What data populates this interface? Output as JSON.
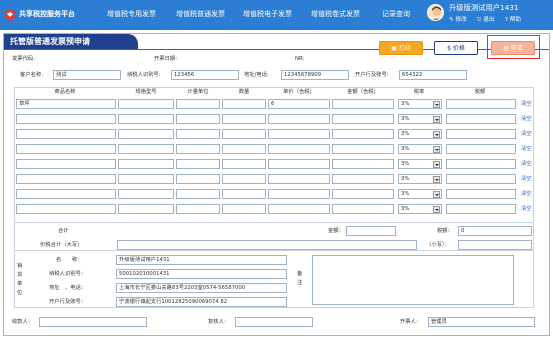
{
  "topbar": {
    "brand": "共享税控服务平台",
    "nav": [
      "增值税专用发票",
      "增值税普通发票",
      "增值税电子发票",
      "增值税卷式发票",
      "记录查询"
    ],
    "user_name": "升级版测试用户1431",
    "links": {
      "edit": "修改",
      "logout": "退出",
      "help": "帮助"
    },
    "bg_color": "#2b7ed3"
  },
  "page": {
    "title": "托管版普通发票预申请",
    "buttons": {
      "print": "打印",
      "price": "价格",
      "apply": "申请"
    },
    "meta": {
      "invoice_code": "发票代码:",
      "issue_date": "开票日期:",
      "no": "NR:"
    }
  },
  "buyer": {
    "name_label": "客户名称:",
    "name": "测试",
    "tax_label": "纳税人识别号:",
    "tax_id": "123456",
    "addr_label": "地址/电话:",
    "addr": "12345678909",
    "bank_label": "开户行及账号:",
    "bank": "654322"
  },
  "table": {
    "headers": [
      "商品名称",
      "规格型号",
      "计量单位",
      "数量",
      "单价（含税）",
      "金额（含税）",
      "税率",
      "税额"
    ],
    "rows": [
      {
        "name": "草坪",
        "spec": "",
        "unit": "",
        "qty": "",
        "price": "6",
        "amount": "",
        "rate": "3%",
        "tax": "",
        "clear": "清空"
      },
      {
        "name": "",
        "spec": "",
        "unit": "",
        "qty": "",
        "price": "",
        "amount": "",
        "rate": "3%",
        "tax": "",
        "clear": "清空"
      },
      {
        "name": "",
        "spec": "",
        "unit": "",
        "qty": "",
        "price": "",
        "amount": "",
        "rate": "3%",
        "tax": "",
        "clear": "清空"
      },
      {
        "name": "",
        "spec": "",
        "unit": "",
        "qty": "",
        "price": "",
        "amount": "",
        "rate": "3%",
        "tax": "",
        "clear": "清空"
      },
      {
        "name": "",
        "spec": "",
        "unit": "",
        "qty": "",
        "price": "",
        "amount": "",
        "rate": "3%",
        "tax": "",
        "clear": "清空"
      },
      {
        "name": "",
        "spec": "",
        "unit": "",
        "qty": "",
        "price": "",
        "amount": "",
        "rate": "3%",
        "tax": "",
        "clear": "清空"
      },
      {
        "name": "",
        "spec": "",
        "unit": "",
        "qty": "",
        "price": "",
        "amount": "",
        "rate": "3%",
        "tax": "",
        "clear": "清空"
      },
      {
        "name": "",
        "spec": "",
        "unit": "",
        "qty": "",
        "price": "",
        "amount": "",
        "rate": "3%",
        "tax": "",
        "clear": "清空"
      }
    ]
  },
  "totals": {
    "subtotal_label": "合计",
    "amount_label": "金额：",
    "tax_label": "税额：",
    "tax_value": "0",
    "grand_label": "价税合计（大写）",
    "small_label": "（小写）："
  },
  "seller": {
    "section_label": "销货单位",
    "name_label": "名　　称：",
    "name": "升级版测试用户1431",
    "tax_label": "纳税人识别号：",
    "tax_id": "500102010001431",
    "addr_label": "地址　、电话：",
    "addr": "上海市长宁区娄山关路83号2203室0574-56587000",
    "bank_label": "开户行及账号：",
    "bank": "宁波银行镇起支行10012825090069074 82",
    "remark_label": "备注"
  },
  "footer": {
    "payee_label": "收款人：",
    "reviewer_label": "复核人：",
    "drawer_label": "开票人：",
    "drawer": "管理员"
  }
}
